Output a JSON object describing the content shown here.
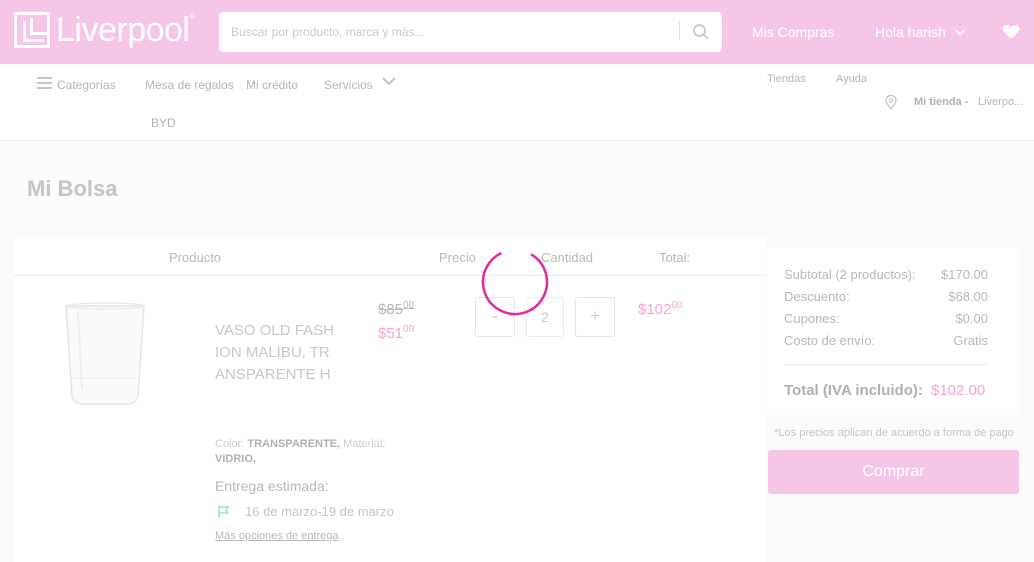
{
  "header": {
    "logo_text": "Liverpool",
    "logo_reg": "®",
    "search_placeholder": "Buscar por producto, marca y más...",
    "my_purchases": "Mis Compras",
    "greeting": "Hola harish"
  },
  "nav": {
    "categories": "Categorías",
    "gift_table": "Mesa de regalos",
    "credit": "Mi crédito",
    "services": "Servicios",
    "byd": "BYD",
    "stores": "Tiendas",
    "help": "Ayuda",
    "my_store_label": "Mi tienda -",
    "my_store_value": "Liverpo..."
  },
  "page": {
    "title": "Mi Bolsa"
  },
  "cart": {
    "columns": {
      "product": "Producto",
      "price": "Precio",
      "quantity": "Cantidad",
      "total": "Total:"
    },
    "item": {
      "name": "VASO OLD FASHION MALIBU, TRANSPARENTE H",
      "color_label": "Color:",
      "color_value": "TRANSPARENTE,",
      "material_label": "Material:",
      "material_value": "VIDRIO,",
      "old_price": "$85",
      "old_price_cents": "00",
      "new_price": "$51",
      "new_price_cents": "00",
      "quantity": "2",
      "minus": "-",
      "plus": "+",
      "total": "$102",
      "total_cents": "00",
      "delivery_label": "Entrega estimada:",
      "delivery_dates": "16 de marzo-19 de marzo",
      "more_options": "Más opciones de entrega"
    }
  },
  "summary": {
    "subtotal_label": "Subtotal (2 productos):",
    "subtotal_value": "$170.00",
    "discount_label": "Descuento:",
    "discount_value": "$68.00",
    "coupons_label": "Cupones:",
    "coupons_value": "$0.00",
    "shipping_label": "Costo de envío:",
    "shipping_value": "Gratis",
    "total_label": "Total (IVA incluido):",
    "total_value": "$102.00",
    "note": "*Los precios aplican de acuerdo a forma de pago",
    "buy": "Comprar"
  },
  "colors": {
    "brand": "#f6c6e8",
    "accent": "#e91e8c",
    "price": "#f6a3cf"
  }
}
